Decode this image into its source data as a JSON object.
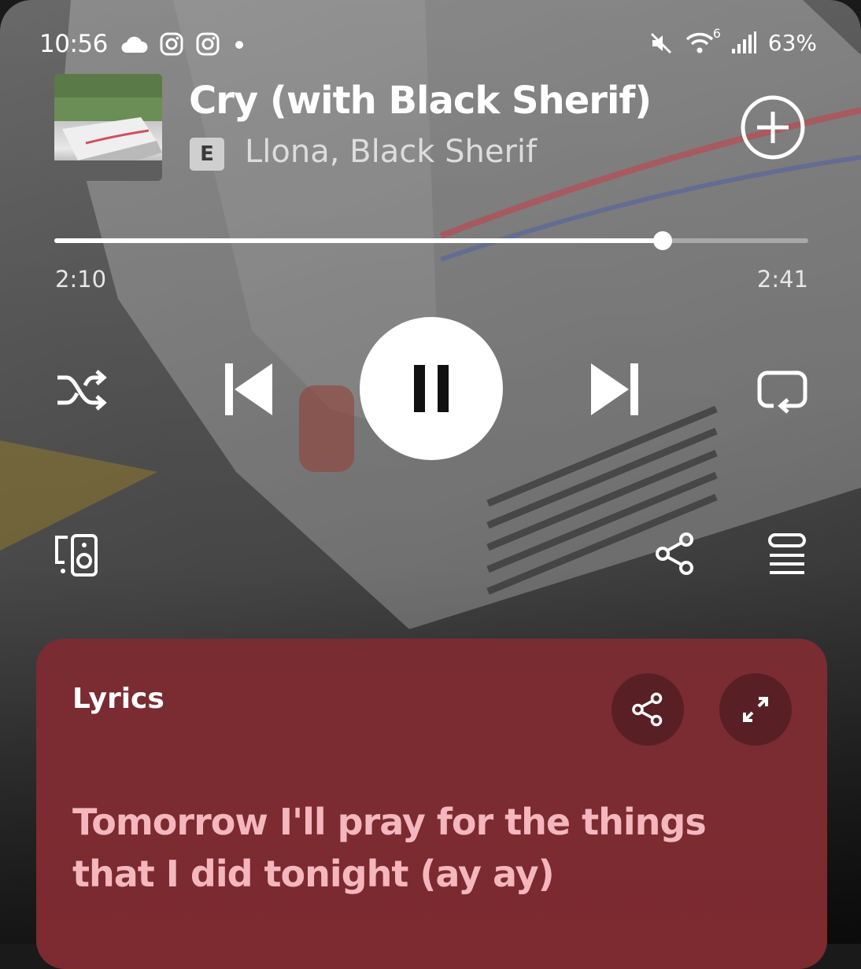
{
  "status_bar": {
    "time": "10:56",
    "battery": "63%",
    "wifi_generation": "6"
  },
  "now_playing": {
    "title": "Cry (with Black Sherif)",
    "explicit_badge": "E",
    "artists": "Llona, Black Sherif",
    "elapsed": "2:10",
    "duration": "2:41",
    "progress_fraction": 0.807
  },
  "controls": {
    "shuffle": "shuffle-icon",
    "previous": "skip-previous-icon",
    "pause": "pause-icon",
    "next": "skip-next-icon",
    "repeat": "repeat-icon",
    "devices": "connect-device-icon",
    "share": "share-icon",
    "queue": "queue-icon"
  },
  "lyrics": {
    "label": "Lyrics",
    "line": "Tomorrow I'll pray for the things that I did tonight (ay ay)",
    "card_color": "#7a2c33",
    "text_color": "#f4b7bd"
  }
}
